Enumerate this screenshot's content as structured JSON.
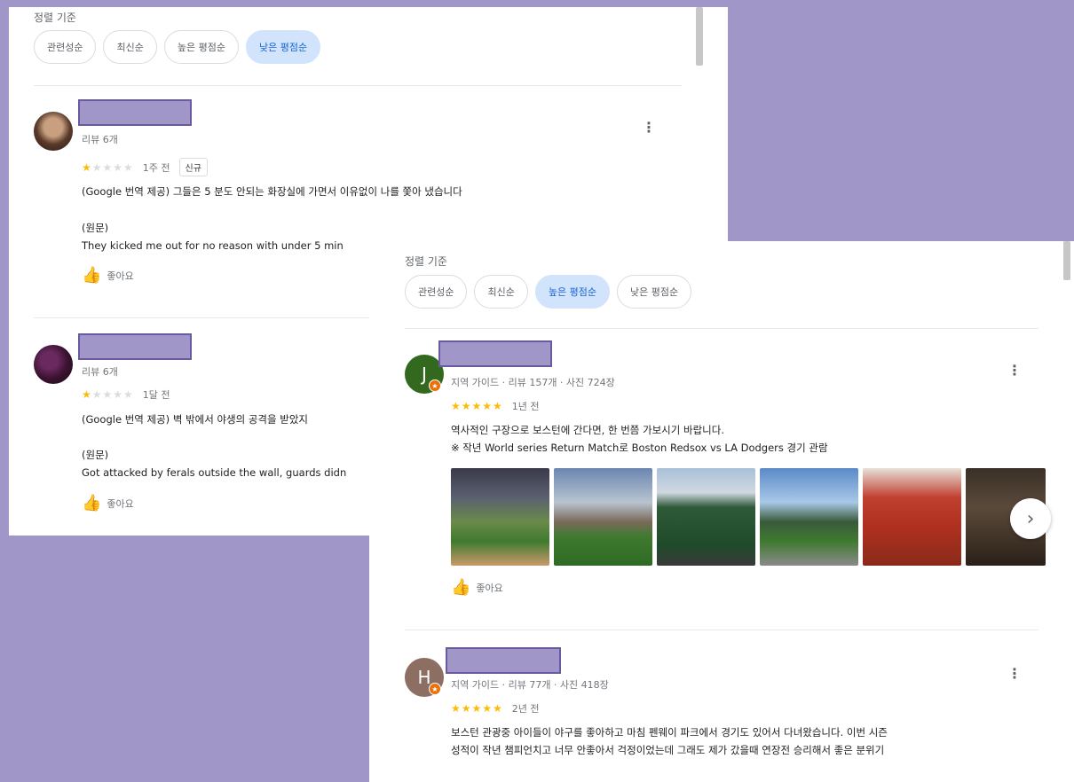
{
  "sort_label": "정렬 기준",
  "panel_a": {
    "chips": [
      {
        "label": "관련성순",
        "active": false
      },
      {
        "label": "최신순",
        "active": false
      },
      {
        "label": "높은 평점순",
        "active": false
      },
      {
        "label": "낮은 평점순",
        "active": true
      }
    ],
    "reviews": [
      {
        "meta": "리뷰 6개",
        "rating": 1,
        "time": "1주 전",
        "tag": "신규",
        "translated": "(Google 번역 제공) 그들은 5 분도 안되는 화장실에 가면서 이유없이 나를 쫓아 냈습니다",
        "original_label": "(원문)",
        "original": "They kicked me out for no reason with under 5 min",
        "like_label": "좋아요"
      },
      {
        "meta": "리뷰 6개",
        "rating": 1,
        "time": "1달 전",
        "translated": "(Google 번역 제공) 벽 밖에서 야생의 공격을 받았지",
        "original_label": "(원문)",
        "original": "Got attacked by ferals outside the wall, guards didn",
        "like_label": "좋아요"
      }
    ]
  },
  "panel_b": {
    "chips": [
      {
        "label": "관련성순",
        "active": false
      },
      {
        "label": "최신순",
        "active": false
      },
      {
        "label": "높은 평점순",
        "active": true
      },
      {
        "label": "낮은 평점순",
        "active": false
      }
    ],
    "reviews": [
      {
        "avatar_letter": "J",
        "avatar_color": "#33691e",
        "meta": "지역 가이드 · 리뷰 157개 · 사진 724장",
        "rating": 5,
        "time": "1년 전",
        "line1": "역사적인 구장으로 보스턴에 간다면, 한 번쯤 가보시기 바랍니다.",
        "line2": "※ 작년 World series Return Match로 Boston Redsox vs LA Dodgers 경기 관람",
        "like_label": "좋아요"
      },
      {
        "avatar_letter": "H",
        "avatar_color": "#8d6e63",
        "meta": "지역 가이드 · 리뷰 77개 · 사진 418장",
        "rating": 5,
        "time": "2년 전",
        "line1": "보스턴 관광중 아이들이 야구를 좋아하고 마침 펜웨이 파크에서 경기도 있어서 다녀왔습니다. 이번 시즌",
        "line2": "성적이 작년 챔피언치고 너무 안좋아서 걱정이었는데 그래도 제가 갔을때 연장전 승리해서 좋은 분위기"
      }
    ]
  },
  "colors": {
    "background": "#a196c8",
    "active_chip": "#d2e3fc",
    "star": "#fbbc04",
    "local_guide_badge": "#e8710a"
  },
  "icons": [
    "thumb-up-icon",
    "more-vert-icon",
    "chevron-right-icon",
    "local-guide-badge-icon"
  ]
}
